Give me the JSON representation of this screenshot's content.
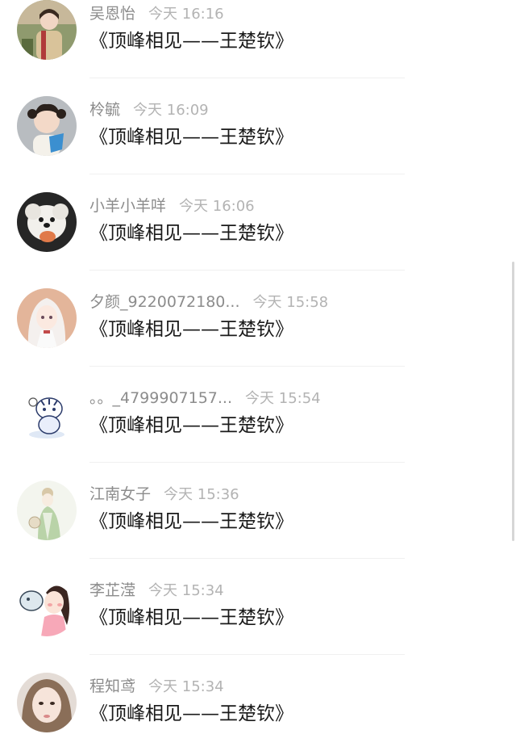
{
  "comments": [
    {
      "name": "吴恩怡",
      "time": "今天 16:16",
      "text": "《顶峰相见——王楚钦》",
      "avatar_icon": "girl-photo-avatar",
      "avatar_color": "#a08a6a"
    },
    {
      "name": "柃毓",
      "time": "今天 16:09",
      "text": "《顶峰相见——王楚钦》",
      "avatar_icon": "baby-photo-avatar",
      "avatar_color": "#6b7a8a"
    },
    {
      "name": "小羊小羊咩",
      "time": "今天 16:06",
      "text": "《顶峰相见——王楚钦》",
      "avatar_icon": "white-dog-avatar",
      "avatar_color": "#2b2b2b"
    },
    {
      "name": "夕颜_9220072180...",
      "time": "今天 15:58",
      "text": "《顶峰相见——王楚钦》",
      "avatar_icon": "anime-girl-avatar",
      "avatar_color": "#d9a98c"
    },
    {
      "name": "。。_4799907157...",
      "time": "今天 15:54",
      "text": "《顶峰相见——王楚钦》",
      "avatar_icon": "cartoon-tiger-avatar",
      "avatar_color": "#ffffff"
    },
    {
      "name": "江南女子",
      "time": "今天 15:36",
      "text": "《顶峰相见——王楚钦》",
      "avatar_icon": "painted-lady-avatar",
      "avatar_color": "#eef2e6"
    },
    {
      "name": "李芷滢",
      "time": "今天 15:34",
      "text": "《顶峰相见——王楚钦》",
      "avatar_icon": "cartoon-girl-fish-avatar",
      "avatar_color": "#ffffff"
    },
    {
      "name": "程知鸢",
      "time": "今天 15:34",
      "text": "《顶峰相见——王楚钦》",
      "avatar_icon": "girl-portrait-avatar",
      "avatar_color": "#d8cdc6"
    }
  ]
}
